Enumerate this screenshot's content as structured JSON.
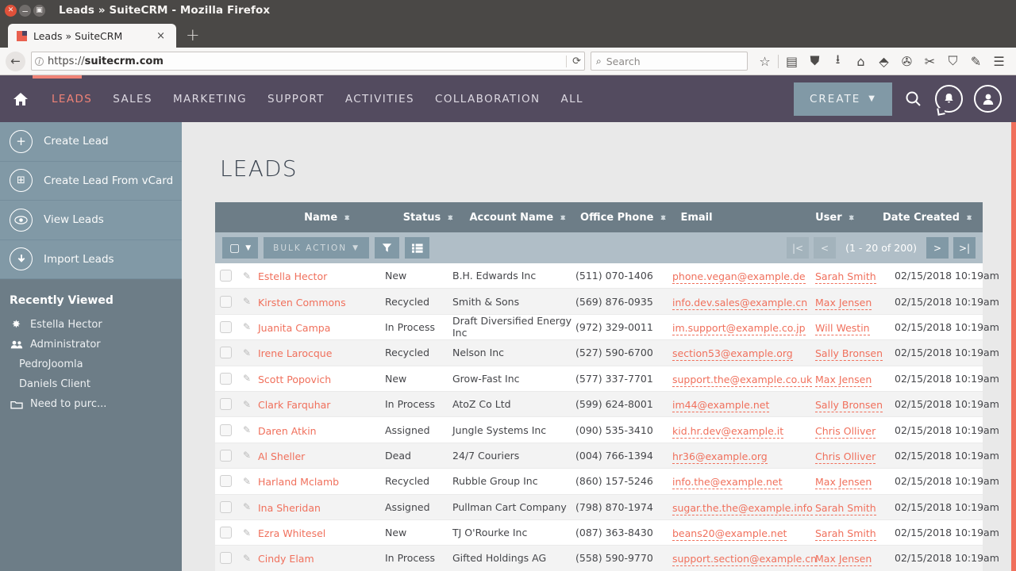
{
  "browser": {
    "window_title": "Leads » SuiteCRM - Mozilla Firefox",
    "tab_title": "Leads » SuiteCRM",
    "tab_close": "×",
    "new_tab": "+",
    "url_scheme": "https://",
    "url_host": "suitecrm.com",
    "search_placeholder": "Search",
    "close_glyph": "✕",
    "min_glyph": "⚊",
    "max_glyph": "▣",
    "back_glyph": "←",
    "reload_glyph": "⟳",
    "info_glyph": "i",
    "toolbar_icons": [
      {
        "name": "bookmark-star-icon",
        "glyph": "☆"
      },
      {
        "name": "reader-list-icon",
        "glyph": "▤"
      },
      {
        "name": "pocket-icon",
        "glyph": "⛊"
      },
      {
        "name": "downloads-icon",
        "glyph": "⭳"
      },
      {
        "name": "home-icon",
        "glyph": "⌂"
      },
      {
        "name": "sync-icon",
        "glyph": "⬘"
      },
      {
        "name": "globe-icon",
        "glyph": "✇"
      },
      {
        "name": "screenshot-icon",
        "glyph": "✂"
      },
      {
        "name": "extension-icon",
        "glyph": "⛉"
      },
      {
        "name": "eyedropper-icon",
        "glyph": "✎"
      },
      {
        "name": "menu-icon",
        "glyph": "☰"
      }
    ]
  },
  "topnav": {
    "home_icon": "⌂",
    "items": [
      {
        "label": "LEADS",
        "active": true
      },
      {
        "label": "SALES",
        "active": false
      },
      {
        "label": "MARKETING",
        "active": false
      },
      {
        "label": "SUPPORT",
        "active": false
      },
      {
        "label": "ACTIVITIES",
        "active": false
      },
      {
        "label": "COLLABORATION",
        "active": false
      },
      {
        "label": "ALL",
        "active": false
      }
    ],
    "create_label": "CREATE",
    "create_caret": "▼",
    "search_glyph": "⌕",
    "bell_glyph": "🔔",
    "user_glyph": "☺"
  },
  "sidebar": {
    "actions": [
      {
        "label": "Create Lead",
        "icon": "plus-circle-icon",
        "glyph": "+"
      },
      {
        "label": "Create Lead From vCard",
        "icon": "card-plus-icon",
        "glyph": "⊞"
      },
      {
        "label": "View Leads",
        "icon": "eye-icon",
        "glyph": "◉"
      },
      {
        "label": "Import Leads",
        "icon": "download-arrow-icon",
        "glyph": "↓"
      }
    ],
    "recent_title": "Recently Viewed",
    "recent": [
      {
        "label": "Estella Hector",
        "icon": "star-burst-icon",
        "glyph": "✸"
      },
      {
        "label": "Administrator",
        "icon": "users-icon",
        "glyph": "👥"
      },
      {
        "label": "PedroJoomla",
        "icon": "",
        "glyph": ""
      },
      {
        "label": "Daniels Client",
        "icon": "",
        "glyph": ""
      },
      {
        "label": "Need to purc...",
        "icon": "folder-icon",
        "glyph": "▭"
      }
    ],
    "collapse_glyph": "◁"
  },
  "page": {
    "title": "LEADS"
  },
  "listview": {
    "columns": [
      {
        "label": "Name",
        "sortable": true
      },
      {
        "label": "Status",
        "sortable": true
      },
      {
        "label": "Account Name",
        "sortable": true
      },
      {
        "label": "Office Phone",
        "sortable": true
      },
      {
        "label": "Email",
        "sortable": false
      },
      {
        "label": "User",
        "sortable": true
      },
      {
        "label": "Date Created",
        "sortable": true
      }
    ],
    "toolbar": {
      "select_glyph": "▢",
      "select_caret": "▼",
      "bulk_action_label": "BULK ACTION",
      "bulk_caret": "▼",
      "filter_glyph": "▼",
      "columns_glyph": "☷"
    },
    "pager": {
      "first": "|<",
      "prev": "<",
      "count": "(1 - 20 of 200)",
      "next": ">",
      "last": ">|"
    },
    "edit_glyph": "✎",
    "info_glyph": "i",
    "rows": [
      {
        "name": "Estella Hector",
        "status": "New",
        "account": "B.H. Edwards Inc",
        "phone": "(511) 070-1406",
        "email": "phone.vegan@example.de",
        "user": "Sarah Smith",
        "date": "02/15/2018 10:19am"
      },
      {
        "name": "Kirsten Commons",
        "status": "Recycled",
        "account": "Smith & Sons",
        "phone": "(569) 876-0935",
        "email": "info.dev.sales@example.cn",
        "user": "Max Jensen",
        "date": "02/15/2018 10:19am"
      },
      {
        "name": "Juanita Campa",
        "status": "In Process",
        "account": "Draft Diversified Energy Inc",
        "phone": "(972) 329-0011",
        "email": "im.support@example.co.jp",
        "user": "Will Westin",
        "date": "02/15/2018 10:19am"
      },
      {
        "name": "Irene Larocque",
        "status": "Recycled",
        "account": "Nelson Inc",
        "phone": "(527) 590-6700",
        "email": "section53@example.org",
        "user": "Sally Bronsen",
        "date": "02/15/2018 10:19am"
      },
      {
        "name": "Scott Popovich",
        "status": "New",
        "account": "Grow-Fast Inc",
        "phone": "(577) 337-7701",
        "email": "support.the@example.co.uk",
        "user": "Max Jensen",
        "date": "02/15/2018 10:19am"
      },
      {
        "name": "Clark Farquhar",
        "status": "In Process",
        "account": "AtoZ Co Ltd",
        "phone": "(599) 624-8001",
        "email": "im44@example.net",
        "user": "Sally Bronsen",
        "date": "02/15/2018 10:19am"
      },
      {
        "name": "Daren Atkin",
        "status": "Assigned",
        "account": "Jungle Systems Inc",
        "phone": "(090) 535-3410",
        "email": "kid.hr.dev@example.it",
        "user": "Chris Olliver",
        "date": "02/15/2018 10:19am"
      },
      {
        "name": "Al Sheller",
        "status": "Dead",
        "account": "24/7 Couriers",
        "phone": "(004) 766-1394",
        "email": "hr36@example.org",
        "user": "Chris Olliver",
        "date": "02/15/2018 10:19am"
      },
      {
        "name": "Harland Mclamb",
        "status": "Recycled",
        "account": "Rubble Group Inc",
        "phone": "(860) 157-5246",
        "email": "info.the@example.net",
        "user": "Max Jensen",
        "date": "02/15/2018 10:19am"
      },
      {
        "name": "Ina Sheridan",
        "status": "Assigned",
        "account": "Pullman Cart Company",
        "phone": "(798) 870-1974",
        "email": "sugar.the.the@example.info",
        "user": "Sarah Smith",
        "date": "02/15/2018 10:19am"
      },
      {
        "name": "Ezra Whitesel",
        "status": "New",
        "account": "TJ O'Rourke Inc",
        "phone": "(087) 363-8430",
        "email": "beans20@example.net",
        "user": "Sarah Smith",
        "date": "02/15/2018 10:19am"
      },
      {
        "name": "Cindy Elam",
        "status": "In Process",
        "account": "Gifted Holdings AG",
        "phone": "(558) 590-9770",
        "email": "support.section@example.cn",
        "user": "Max Jensen",
        "date": "02/15/2018 10:19am"
      }
    ]
  },
  "colors": {
    "accent_coral": "#f0705c",
    "nav_purple": "#534b5f",
    "slate": "#6d7d87",
    "slate_light": "#8199a6",
    "toolbar_blue": "#b0bec7"
  }
}
